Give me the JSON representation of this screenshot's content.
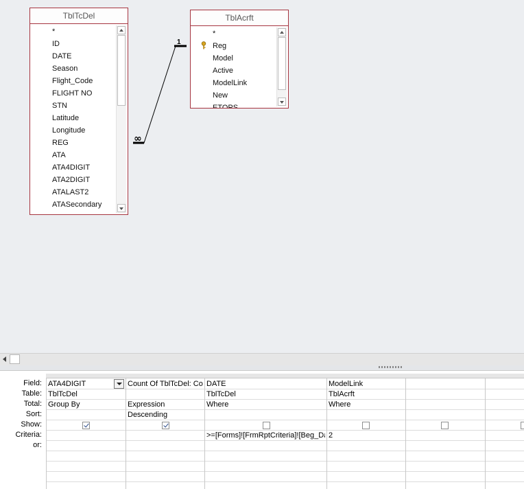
{
  "tables": [
    {
      "name": "TblTcDel",
      "fields": [
        "*",
        "ID",
        "DATE",
        "Season",
        "Flight_Code",
        "FLIGHT NO",
        "STN",
        "Latitude",
        "Longitude",
        "REG",
        "ATA",
        "ATA4DIGIT",
        "ATA2DIGIT",
        "ATALAST2",
        "ATASecondary"
      ]
    },
    {
      "name": "TblAcrft",
      "fields": [
        "*",
        "Reg",
        "Model",
        "Active",
        "ModelLink",
        "New",
        "ETOPS"
      ],
      "key_field": "Reg"
    }
  ],
  "relationship": {
    "one_label": "1",
    "many_label": "∞"
  },
  "grid": {
    "row_labels": [
      "Field:",
      "Table:",
      "Total:",
      "Sort:",
      "Show:",
      "Criteria:",
      "or:"
    ],
    "columns": [
      {
        "field": "ATA4DIGIT",
        "table": "TblTcDel",
        "total": "Group By",
        "sort": "",
        "show": true,
        "criteria": ""
      },
      {
        "field": "Count Of TblTcDel: Count(TblTcDel.ID)",
        "table": "",
        "total": "Expression",
        "sort": "Descending",
        "show": true,
        "criteria": ""
      },
      {
        "field": "DATE",
        "table": "TblTcDel",
        "total": "Where",
        "sort": "",
        "show": false,
        "criteria": ">=[Forms]![FrmRptCriteria]![Beg_Date]"
      },
      {
        "field": "ModelLink",
        "table": "TblAcrft",
        "total": "Where",
        "sort": "",
        "show": false,
        "criteria": "2"
      },
      {
        "field": "",
        "table": "",
        "total": "",
        "sort": "",
        "show": false,
        "criteria": ""
      },
      {
        "field": "",
        "table": "",
        "total": "",
        "sort": "",
        "show": false,
        "criteria": ""
      }
    ]
  }
}
